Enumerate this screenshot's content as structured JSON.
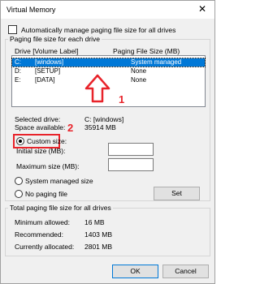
{
  "window": {
    "title": "Virtual Memory",
    "close_glyph": "✕"
  },
  "auto_manage": {
    "label": "Automatically manage paging file size for all drives",
    "checked": false
  },
  "group_drives": {
    "legend": "Paging file size for each drive",
    "columns": {
      "drive": "Drive [Volume Label]",
      "size": "Paging File Size (MB)"
    },
    "rows": [
      {
        "drive": "C:",
        "label": "[windows]",
        "size": "System managed",
        "selected": true
      },
      {
        "drive": "D:",
        "label": "[SETUP]",
        "size": "None"
      },
      {
        "drive": "E:",
        "label": "[DATA]",
        "size": "None"
      }
    ],
    "selected_drive_label": "Selected drive:",
    "selected_drive_value": "C:  [windows]",
    "space_available_label": "Space available:",
    "space_available_value": "35914 MB",
    "custom_size_label": "Custom size:",
    "initial_size_label": "Initial size (MB):",
    "initial_size_value": "",
    "maximum_size_label": "Maximum size (MB):",
    "maximum_size_value": "",
    "system_managed_label": "System managed size",
    "no_paging_label": "No paging file",
    "set_button": "Set",
    "selected_option": "custom"
  },
  "group_totals": {
    "legend": "Total paging file size for all drives",
    "minimum_label": "Minimum allowed:",
    "minimum_value": "16 MB",
    "recommended_label": "Recommended:",
    "recommended_value": "1403 MB",
    "allocated_label": "Currently allocated:",
    "allocated_value": "2801 MB"
  },
  "buttons": {
    "ok": "OK",
    "cancel": "Cancel"
  },
  "annotations": {
    "marker_1": "1",
    "marker_2": "2",
    "color": "#e8232a"
  }
}
